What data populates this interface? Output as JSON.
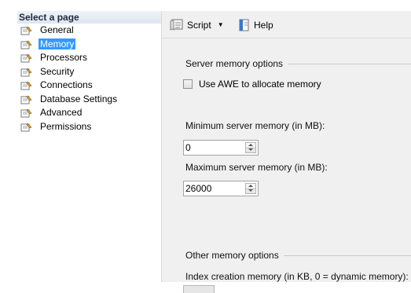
{
  "left_pane": {
    "header": "Select a page",
    "items": [
      {
        "label": "General",
        "selected": false
      },
      {
        "label": "Memory",
        "selected": true
      },
      {
        "label": "Processors",
        "selected": false
      },
      {
        "label": "Security",
        "selected": false
      },
      {
        "label": "Connections",
        "selected": false
      },
      {
        "label": "Database Settings",
        "selected": false
      },
      {
        "label": "Advanced",
        "selected": false
      },
      {
        "label": "Permissions",
        "selected": false
      }
    ],
    "icon": "page-wrench-icon"
  },
  "toolbar": {
    "script_label": "Script",
    "help_label": "Help"
  },
  "server_memory": {
    "group_title": "Server memory options",
    "awe_checkbox_label": "Use AWE to allocate memory",
    "awe_checked": false,
    "min_label": "Minimum server memory (in MB):",
    "min_value": "0",
    "max_label": "Maximum server memory (in MB):",
    "max_value": "26000"
  },
  "other_memory": {
    "group_title": "Other memory options",
    "index_label": "Index creation memory (in KB, 0 = dynamic memory):"
  },
  "colors": {
    "selection": "#3399ff",
    "pane_background": "#f0f0f0"
  }
}
